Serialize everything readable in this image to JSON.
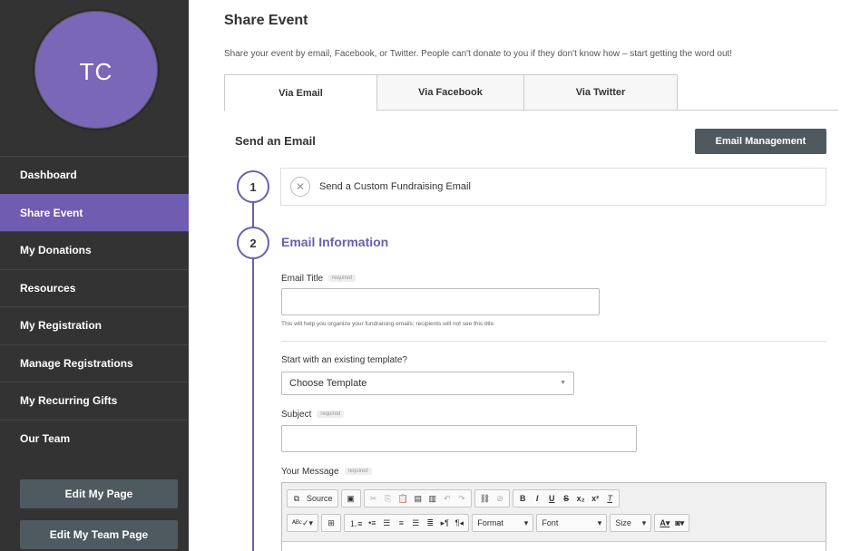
{
  "user": {
    "initials": "TC"
  },
  "sidebar": {
    "items": [
      {
        "label": "Dashboard",
        "active": false
      },
      {
        "label": "Share Event",
        "active": true
      },
      {
        "label": "My Donations",
        "active": false
      },
      {
        "label": "Resources",
        "active": false
      },
      {
        "label": "My Registration",
        "active": false
      },
      {
        "label": "Manage Registrations",
        "active": false
      },
      {
        "label": "My Recurring Gifts",
        "active": false
      },
      {
        "label": "Our Team",
        "active": false
      }
    ],
    "edit_page_label": "Edit My Page",
    "edit_team_label": "Edit My Team Page"
  },
  "page": {
    "title": "Share Event",
    "description": "Share your event by email, Facebook, or Twitter. People can't donate to you if they don't know how – start getting the word out!"
  },
  "tabs": [
    {
      "label": "Via Email",
      "active": true
    },
    {
      "label": "Via Facebook",
      "active": false
    },
    {
      "label": "Via Twitter",
      "active": false
    }
  ],
  "email": {
    "section_title": "Send an Email",
    "management_label": "Email Management",
    "step1": {
      "number": "1",
      "label": "Send a Custom Fundraising Email"
    },
    "step2": {
      "number": "2",
      "title": "Email Information"
    },
    "fields": {
      "title_label": "Email Title",
      "required_tag": "required",
      "title_help": "This will help you organize your fundraising emails; recipients will not see this title",
      "template_label": "Start with an existing template?",
      "template_value": "Choose Template",
      "subject_label": "Subject",
      "message_label": "Your Message"
    },
    "toolbar": {
      "source": "Source",
      "format": "Format",
      "font": "Font",
      "size": "Size"
    }
  },
  "colors": {
    "accent": "#6e5db0",
    "sidebar": "#333333",
    "button": "#4f5960"
  }
}
